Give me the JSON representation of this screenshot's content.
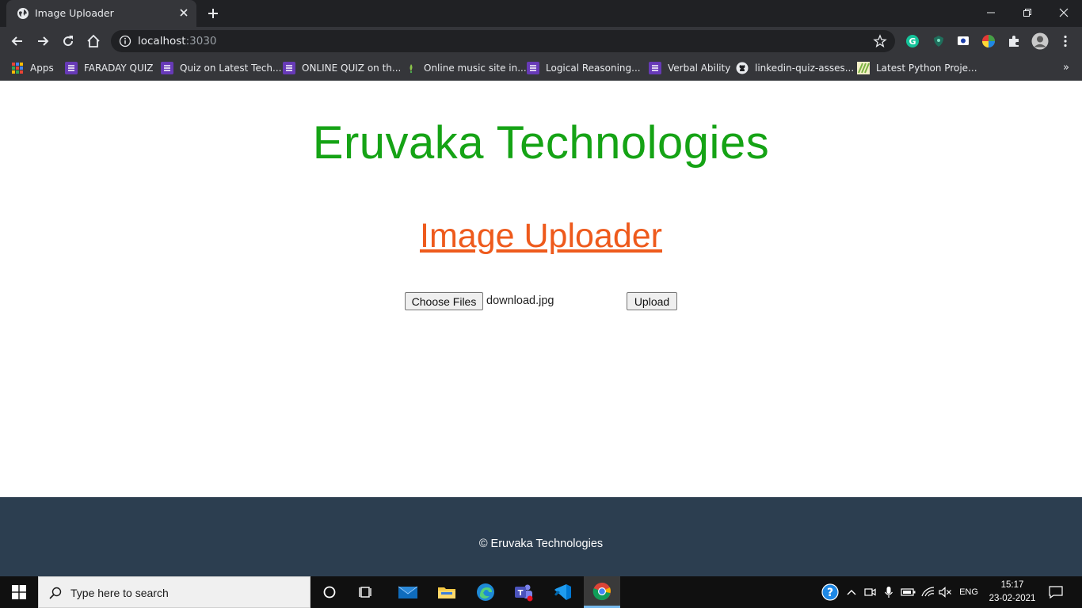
{
  "browser": {
    "tab_title": "Image Uploader",
    "url_host": "localhost",
    "url_port": ":3030",
    "bookmarks": [
      {
        "label": "Apps",
        "icon": "apps-grid-icon"
      },
      {
        "label": "FARADAY QUIZ",
        "icon": "list-icon"
      },
      {
        "label": "Quiz on Latest Tech...",
        "icon": "list-icon"
      },
      {
        "label": "ONLINE QUIZ on th...",
        "icon": "list-icon"
      },
      {
        "label": "Online music site in...",
        "icon": "music-leaf-icon"
      },
      {
        "label": "Logical Reasoning...",
        "icon": "list-icon"
      },
      {
        "label": "Verbal Ability",
        "icon": "list-icon"
      },
      {
        "label": "linkedin-quiz-asses...",
        "icon": "github-icon"
      },
      {
        "label": "Latest Python Proje...",
        "icon": "python-leaf-icon"
      }
    ],
    "bookmarks_overflow": "»"
  },
  "page": {
    "company_title": "Eruvaka Technologies",
    "uploader_heading": "Image Uploader",
    "choose_files_label": "Choose Files",
    "selected_file": "download.jpg",
    "upload_label": "Upload"
  },
  "footer": {
    "copyright": "© Eruvaka Technologies"
  },
  "taskbar": {
    "search_placeholder": "Type here to search",
    "language": "ENG",
    "time": "15:17",
    "date": "23-02-2021"
  },
  "colors": {
    "company_title": "#15a315",
    "uploader_heading": "#ee5a1c",
    "footer_bg": "#2c3e50",
    "chrome_dark": "#202124",
    "chrome_toolbar": "#35363a"
  }
}
